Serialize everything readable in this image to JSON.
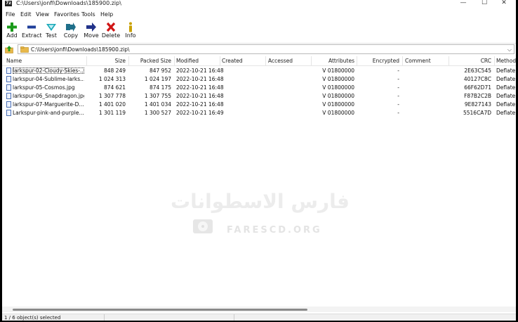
{
  "window": {
    "title": "C:\\Users\\jonfi\\Downloads\\185900.zip\\",
    "app_icon_text": "7z",
    "minimize": "—",
    "maximize": "☐",
    "close": "✕"
  },
  "menu": [
    {
      "label": "File"
    },
    {
      "label": "Edit"
    },
    {
      "label": "View"
    },
    {
      "label": "Favorites"
    },
    {
      "label": "Tools"
    },
    {
      "label": "Help"
    }
  ],
  "toolbar": {
    "add": "Add",
    "extract": "Extract",
    "test": "Test",
    "copy": "Copy",
    "move": "Move",
    "delete": "Delete",
    "info": "Info"
  },
  "address": {
    "path": "C:\\Users\\jonfi\\Downloads\\185900.zip\\"
  },
  "columns": {
    "name": "Name",
    "size": "Size",
    "packed": "Packed Size",
    "modified": "Modified",
    "created": "Created",
    "accessed": "Accessed",
    "attributes": "Attributes",
    "encrypted": "Encrypted",
    "comment": "Comment",
    "crc": "CRC",
    "method": "Method"
  },
  "files": [
    {
      "name": "larkspur-02-Cloudy-Skies-...",
      "size": "848 249",
      "packed": "847 952",
      "modified": "2022-10-21 16:48",
      "attributes": "V 01800000",
      "encrypted": "-",
      "crc": "2E63C545",
      "method": "Deflate"
    },
    {
      "name": "larkspur-04-Sublime-larks...",
      "size": "1 024 313",
      "packed": "1 024 197",
      "modified": "2022-10-21 16:48",
      "attributes": "V 01800000",
      "encrypted": "-",
      "crc": "40127C8C",
      "method": "Deflate"
    },
    {
      "name": "larkspur-05-Cosmos.jpg",
      "size": "874 621",
      "packed": "874 175",
      "modified": "2022-10-21 16:48",
      "attributes": "V 01800000",
      "encrypted": "-",
      "crc": "66F62D71",
      "method": "Deflate"
    },
    {
      "name": "larkspur-06_Snapdragon.jpg",
      "size": "1 307 778",
      "packed": "1 307 755",
      "modified": "2022-10-21 16:48",
      "attributes": "V 01800000",
      "encrypted": "-",
      "crc": "F87B2C2B",
      "method": "Deflate"
    },
    {
      "name": "larkspur-07-Marguerite-D...",
      "size": "1 401 020",
      "packed": "1 401 034",
      "modified": "2022-10-21 16:48",
      "attributes": "V 01800000",
      "encrypted": "-",
      "crc": "9E827143",
      "method": "Deflate"
    },
    {
      "name": "Larkspur-pink-and-purple...",
      "size": "1 301 119",
      "packed": "1 300 527",
      "modified": "2022-10-21 16:49",
      "attributes": "V 01800000",
      "encrypted": "-",
      "crc": "5516CA7D",
      "method": "Deflate"
    }
  ],
  "watermark": {
    "arabic": "فارس الاسطوانات",
    "latin": "FARESCD.ORG"
  },
  "status": {
    "text": "1 / 6 object(s) selected"
  },
  "colors": {
    "add_icon": "#1a9a1a",
    "extract_icon": "#1f3f9a",
    "test_icon": "#19a8b8",
    "copy_icon": "#1f6f8a",
    "move_icon": "#22338a",
    "delete_icon": "#d01515",
    "info_icon": "#c9a000",
    "folder": "#e8b84a"
  }
}
